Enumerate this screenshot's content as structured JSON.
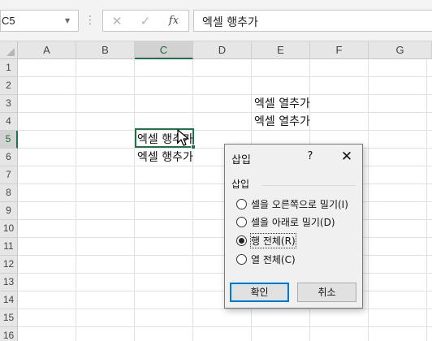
{
  "formula_bar": {
    "name_box": "C5",
    "cancel_glyph": "✕",
    "enter_glyph": "✓",
    "fx_label": "fx",
    "formula": "엑셀 행추가"
  },
  "columns": [
    "A",
    "B",
    "C",
    "D",
    "E",
    "F",
    "G"
  ],
  "rows": [
    "1",
    "2",
    "3",
    "4",
    "5",
    "6",
    "7",
    "8",
    "9",
    "10",
    "11",
    "12",
    "13",
    "14",
    "15",
    "16"
  ],
  "selected_cell": {
    "column": "C",
    "row": "5"
  },
  "cells": {
    "E3": "엑셀 열추가",
    "E4": "엑셀 열추가",
    "C5": "엑셀 행추가",
    "C6": "엑셀 행추가"
  },
  "dialog": {
    "title": "삽입",
    "help": "?",
    "close": "✕",
    "group_label": "삽입",
    "options": [
      {
        "label": "셀을 오른쪽으로 밀기(I)",
        "selected": false
      },
      {
        "label": "셀을 아래로 밀기(D)",
        "selected": false
      },
      {
        "label": "행 전체(R)",
        "selected": true
      },
      {
        "label": "열 전체(C)",
        "selected": false
      }
    ],
    "ok_label": "확인",
    "cancel_label": "취소"
  },
  "colors": {
    "selection_accent": "#217346",
    "dialog_primary_border": "#0078d7"
  }
}
